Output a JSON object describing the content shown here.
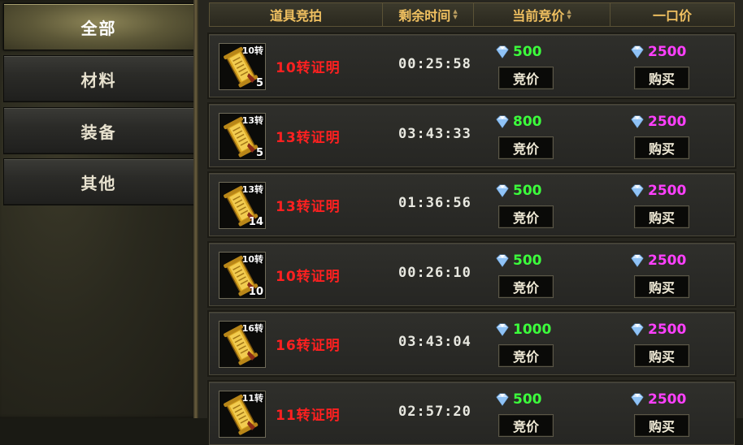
{
  "categories": [
    {
      "label": "全部",
      "active": true
    },
    {
      "label": "材料",
      "active": false
    },
    {
      "label": "装备",
      "active": false
    },
    {
      "label": "其他",
      "active": false
    }
  ],
  "headers": {
    "item": "道具竞拍",
    "time": "剩余时间",
    "bid": "当前竞价",
    "buyout": "一口价"
  },
  "buttons": {
    "bid": "竞价",
    "buy": "购买"
  },
  "items": [
    {
      "icon_label": "10转",
      "count": "5",
      "name": "10转证明",
      "time": "00:25:58",
      "bid": "500",
      "buyout": "2500"
    },
    {
      "icon_label": "13转",
      "count": "5",
      "name": "13转证明",
      "time": "03:43:33",
      "bid": "800",
      "buyout": "2500"
    },
    {
      "icon_label": "13转",
      "count": "14",
      "name": "13转证明",
      "time": "01:36:56",
      "bid": "500",
      "buyout": "2500"
    },
    {
      "icon_label": "10转",
      "count": "10",
      "name": "10转证明",
      "time": "00:26:10",
      "bid": "500",
      "buyout": "2500"
    },
    {
      "icon_label": "16转",
      "count": "",
      "name": "16转证明",
      "time": "03:43:04",
      "bid": "1000",
      "buyout": "2500"
    },
    {
      "icon_label": "11转",
      "count": "",
      "name": "11转证明",
      "time": "02:57:20",
      "bid": "500",
      "buyout": "2500"
    }
  ],
  "colors": {
    "name": "#ff2020",
    "bid": "#3cff3c",
    "buyout": "#ff40ff",
    "header": "#f0c060"
  }
}
